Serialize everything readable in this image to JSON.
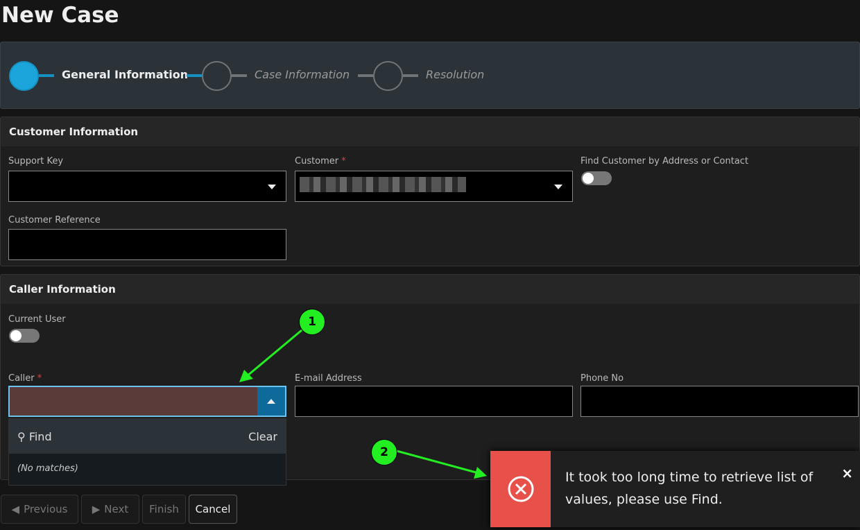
{
  "page_title": "New Case",
  "steps": [
    {
      "label": "General Information",
      "active": true
    },
    {
      "label": "Case Information",
      "active": false
    },
    {
      "label": "Resolution",
      "active": false
    }
  ],
  "customer_section": {
    "title": "Customer Information",
    "support_key": "Support Key",
    "customer": "Customer",
    "required": "*",
    "find_toggle": "Find Customer by Address or Contact",
    "customer_reference": "Customer Reference"
  },
  "caller_section": {
    "title": "Caller Information",
    "current_user": "Current User",
    "caller": "Caller",
    "required": "*",
    "email": "E-mail Address",
    "phone": "Phone No"
  },
  "dropdown": {
    "find": "Find",
    "clear": "Clear",
    "no_matches": "(No matches)"
  },
  "buttons": {
    "previous": "Previous",
    "next": "Next",
    "finish": "Finish",
    "cancel": "Cancel"
  },
  "toast": {
    "message": "It took too long time to retrieve list of values, please use Find.",
    "close": "×"
  },
  "annotations": [
    "1",
    "2"
  ],
  "colors": {
    "accent": "#1ba5da",
    "error": "#e8504a",
    "annotation": "#22ee22"
  }
}
